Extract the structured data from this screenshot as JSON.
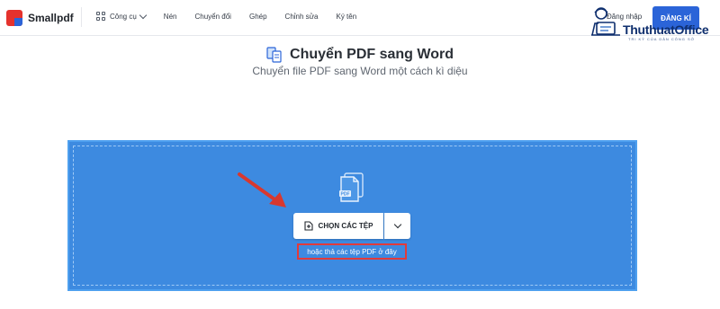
{
  "header": {
    "logo_text": "Smallpdf",
    "tools_label": "Công cụ",
    "nav_items": [
      "Nén",
      "Chuyển đổi",
      "Ghép",
      "Chỉnh sửa",
      "Ký tên"
    ],
    "login_label": "Đăng nhập",
    "signup_label": "ĐĂNG KÍ"
  },
  "watermark": {
    "text": "ThuthuatOffice",
    "sub": "TRI KỶ CỦA DÂN CÔNG SỞ"
  },
  "page": {
    "icon": "convert-doc-icon",
    "title": "Chuyển PDF sang Word",
    "subtitle": "Chuyển file PDF sang Word một cách kì diệu"
  },
  "dropzone": {
    "file_icon_badge": "PDF",
    "choose_button": "CHỌN CÁC TỆP",
    "dropdown_icon": "chevron-down-icon",
    "hint": "hoặc thả các tệp PDF ở đây"
  },
  "colors": {
    "brand_red": "#e5322d",
    "brand_blue": "#2b64d8",
    "dropzone_blue": "#3d8ae0",
    "annotation_red": "#e23a3a"
  }
}
